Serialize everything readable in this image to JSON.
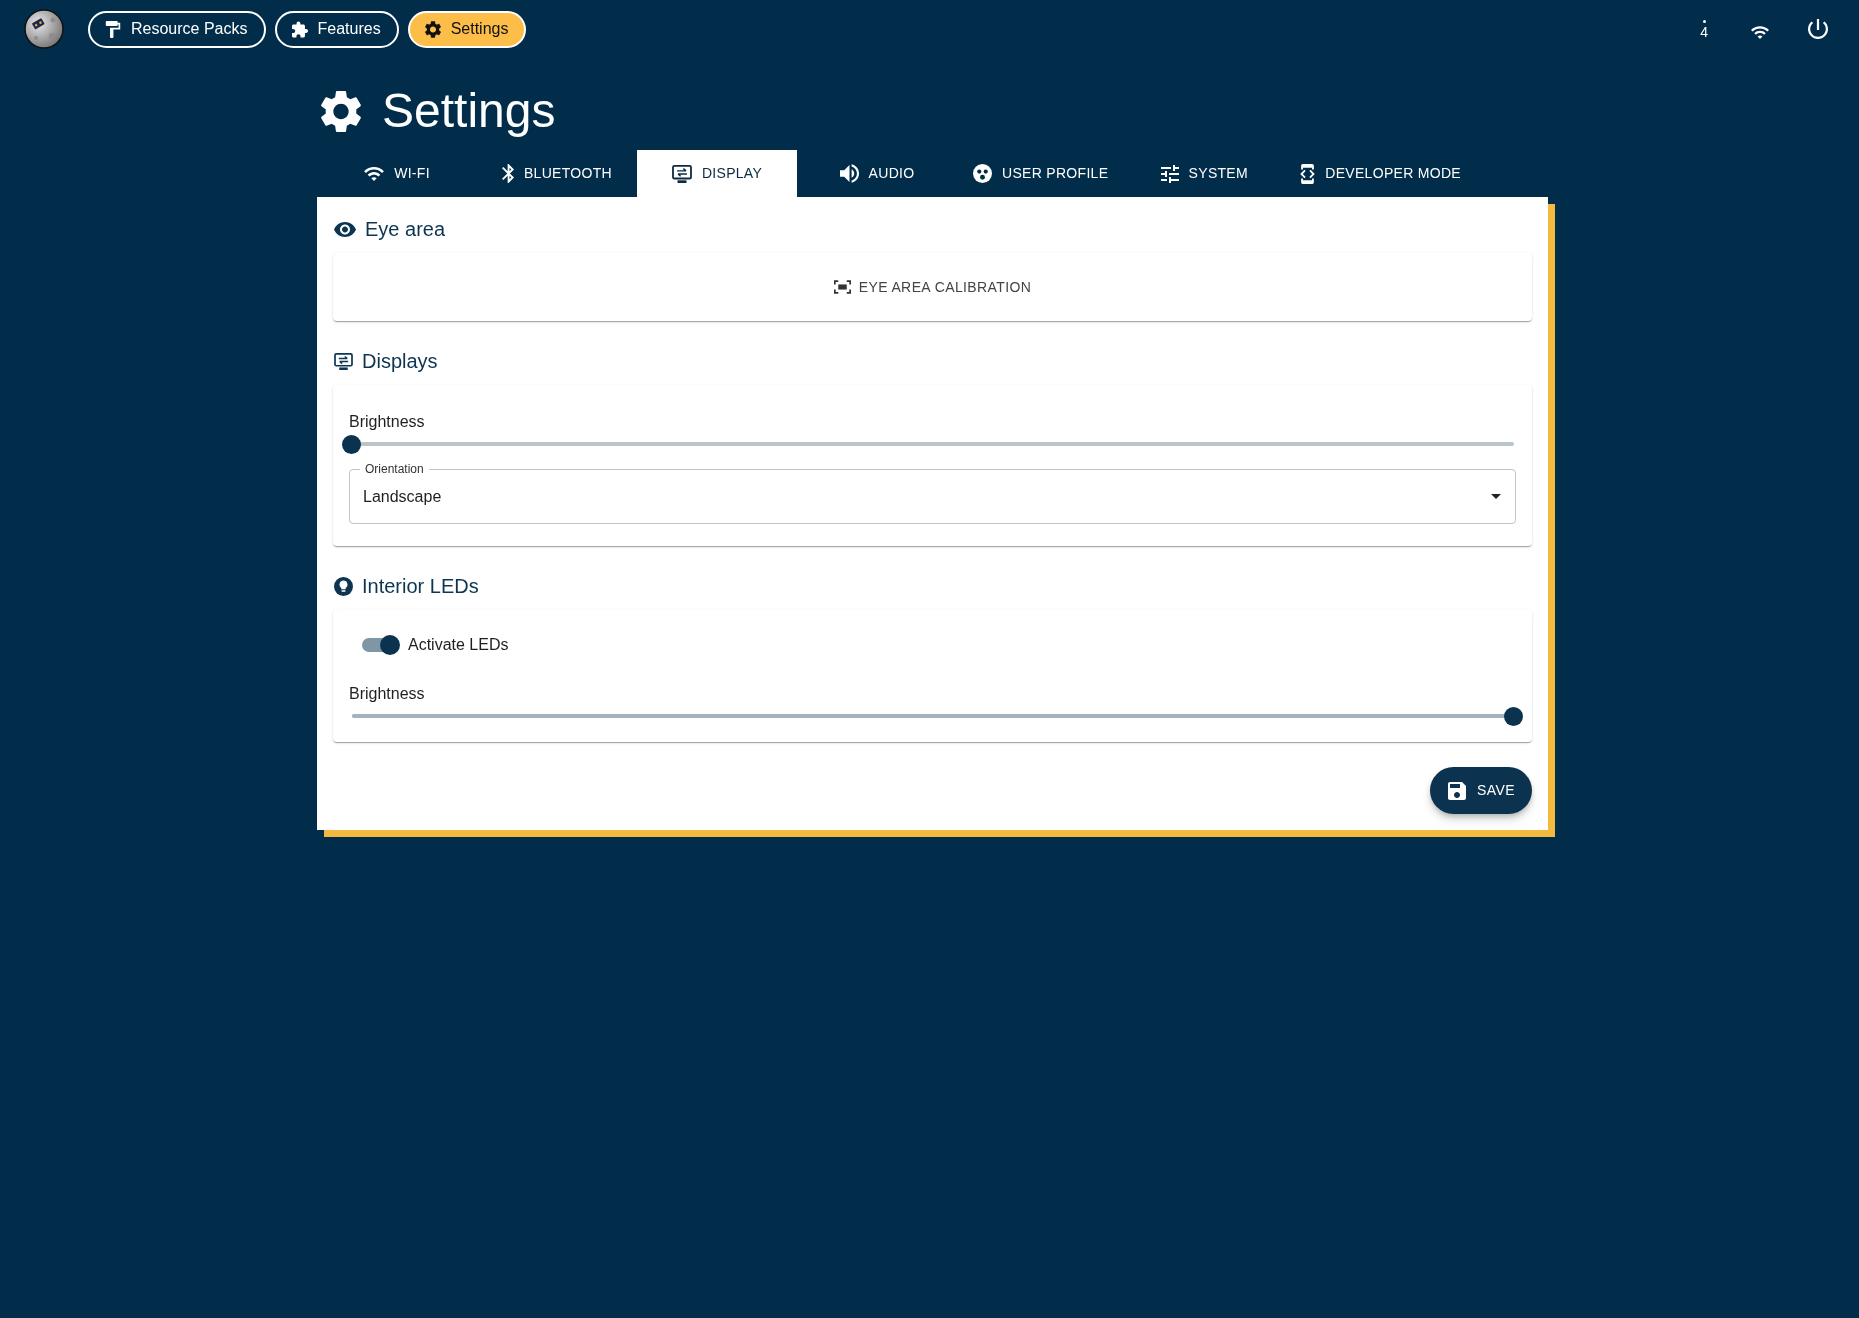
{
  "top_bar": {
    "nav_buttons": [
      {
        "label": "Resource Packs",
        "selected": false
      },
      {
        "label": "Features",
        "selected": false
      },
      {
        "label": "Settings",
        "selected": true
      }
    ],
    "indicator": "4"
  },
  "page_title": "Settings",
  "tabs": [
    {
      "label": "WI-FI",
      "selected": false
    },
    {
      "label": "BLUETOOTH",
      "selected": false
    },
    {
      "label": "DISPLAY",
      "selected": true
    },
    {
      "label": "AUDIO",
      "selected": false
    },
    {
      "label": "USER PROFILE",
      "selected": false
    },
    {
      "label": "SYSTEM",
      "selected": false
    },
    {
      "label": "DEVELOPER MODE",
      "selected": false
    }
  ],
  "sections": [
    {
      "title": "Eye area",
      "controls": [
        {
          "kind": "button",
          "label": "EYE AREA CALIBRATION"
        }
      ]
    },
    {
      "title": "Displays",
      "controls": [
        {
          "kind": "slider",
          "label": "Brightness",
          "level": 0
        },
        {
          "kind": "select",
          "label": "Orientation",
          "value": "Landscape"
        }
      ]
    },
    {
      "title": "Interior LEDs",
      "controls": [
        {
          "kind": "switch",
          "label": "Activate LEDs",
          "on": true
        },
        {
          "kind": "slider",
          "label": "Brightness",
          "level": 1
        }
      ]
    }
  ],
  "save_button": "SAVE"
}
